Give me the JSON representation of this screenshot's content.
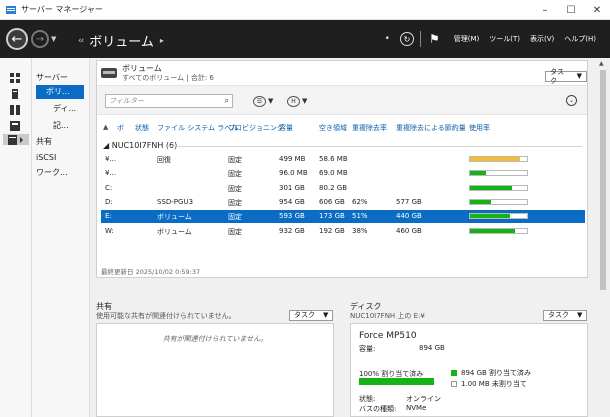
{
  "window": {
    "title": "サーバー マネージャー",
    "controls": [
      "–",
      "☐",
      "✕"
    ]
  },
  "nav": {
    "arrows": "‹‹",
    "breadcrumb": "ボリューム",
    "menus": [
      "管理(M)",
      "ツール(T)",
      "表示(V)",
      "ヘルプ(H)"
    ]
  },
  "sidebar": {
    "items": [
      {
        "label": "サーバー"
      },
      {
        "label": "ボリ..."
      },
      {
        "label": "ディ..."
      },
      {
        "label": "記..."
      },
      {
        "label": "共有"
      },
      {
        "label": "iSCSI"
      },
      {
        "label": "ワーク..."
      }
    ]
  },
  "volumes": {
    "title": "ボリューム",
    "subtitle": "すべてのボリューム | 合計: 6",
    "task_label": "タスク",
    "filter_placeholder": "フィルター",
    "columns": [
      "ボ",
      "状態",
      "ファイル システム ラベル",
      "プロビジョニング",
      "容量",
      "空き領域",
      "重複除去率",
      "重複除去による節約量",
      "使用率"
    ],
    "group": "NUC10I7FNH (6)",
    "rows": [
      {
        "vol": "¥...",
        "status": "",
        "label": "回復",
        "prov": "固定",
        "cap": "499 MB",
        "free": "58.6 MB",
        "rate": "",
        "saving": "",
        "usage": 0.88,
        "state": "warn"
      },
      {
        "vol": "¥...",
        "status": "",
        "label": "",
        "prov": "固定",
        "cap": "96.0 MB",
        "free": "69.0 MB",
        "rate": "",
        "saving": "",
        "usage": 0.28,
        "state": "ok"
      },
      {
        "vol": "C:",
        "status": "",
        "label": "",
        "prov": "固定",
        "cap": "301 GB",
        "free": "80.2 GB",
        "rate": "",
        "saving": "",
        "usage": 0.73,
        "state": "ok"
      },
      {
        "vol": "D:",
        "status": "",
        "label": "SSD-PGU3",
        "prov": "固定",
        "cap": "954 GB",
        "free": "606 GB",
        "rate": "62%",
        "saving": "577 GB",
        "usage": 0.36,
        "state": "ok"
      },
      {
        "vol": "E:",
        "status": "",
        "label": "ボリューム",
        "prov": "固定",
        "cap": "593 GB",
        "free": "173 GB",
        "rate": "51%",
        "saving": "440 GB",
        "usage": 0.71,
        "state": "ok"
      },
      {
        "vol": "W:",
        "status": "",
        "label": "ボリューム",
        "prov": "固定",
        "cap": "932 GB",
        "free": "192 GB",
        "rate": "38%",
        "saving": "460 GB",
        "usage": 0.79,
        "state": "ok"
      }
    ],
    "selected_index": 4,
    "footer": "最終更新日 2025/10/02 0:59:37"
  },
  "shares": {
    "title": "共有",
    "subtitle": "使用可能な共有が関連付けられていません。",
    "task_label": "タスク",
    "empty": "共有が関連付けられていません。"
  },
  "disk": {
    "title": "ディスク",
    "subtitle": "NUC10I7FNH 上の E:¥",
    "task_label": "タスク",
    "name": "Force MP510",
    "capacity_label": "容量:",
    "capacity_value": "894 GB",
    "allocated_pct_label": "100% 割り当て済み",
    "allocated_fraction": 1.0,
    "legend_allocated": "894 GB 割り当て済み",
    "legend_unallocated": "1.00 MB 未割り当て",
    "status_label": "状態:",
    "status_value": "オンライン",
    "bus_label": "バスの種類:",
    "bus_value": "NVMe"
  },
  "colors": {
    "accent": "#0a6cc4",
    "usage_ok": "#16b316",
    "usage_warn": "#f5be32",
    "nav_bg": "#1f1f1f"
  }
}
